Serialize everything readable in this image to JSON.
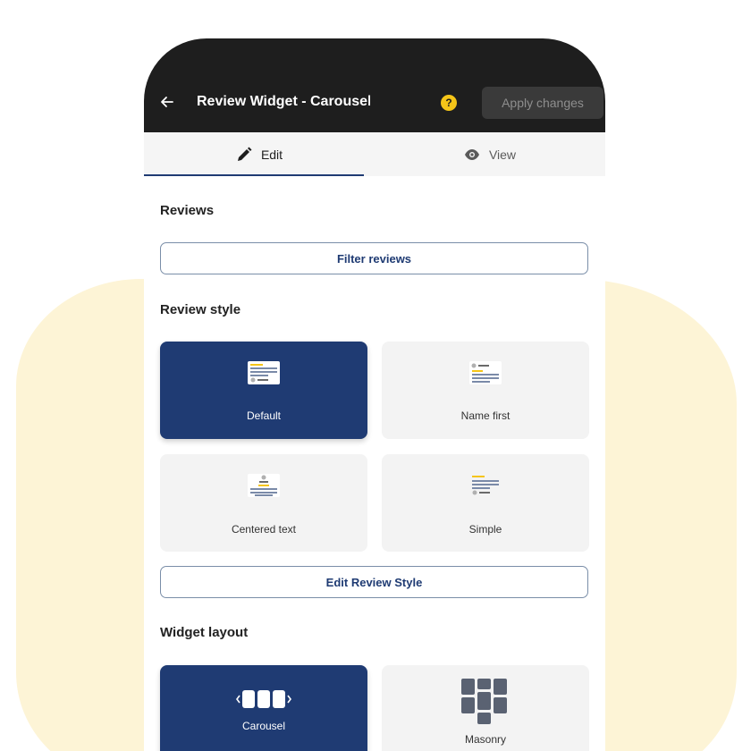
{
  "header": {
    "title": "Review Widget - Carousel",
    "help_label": "?",
    "apply_label": "Apply changes"
  },
  "tabs": [
    {
      "label": "Edit",
      "icon": "pencil-icon",
      "active": true
    },
    {
      "label": "View",
      "icon": "eye-icon",
      "active": false
    }
  ],
  "reviews": {
    "title": "Reviews",
    "filter_label": "Filter reviews"
  },
  "review_style": {
    "title": "Review style",
    "options": [
      {
        "label": "Default",
        "selected": true
      },
      {
        "label": "Name first",
        "selected": false
      },
      {
        "label": "Centered text",
        "selected": false
      },
      {
        "label": "Simple",
        "selected": false
      }
    ],
    "edit_label": "Edit Review Style"
  },
  "widget_layout": {
    "title": "Widget layout",
    "options": [
      {
        "label": "Carousel",
        "selected": true
      },
      {
        "label": "Masonry",
        "selected": false
      }
    ]
  },
  "colors": {
    "primary": "#1f3b73",
    "topbar": "#1e1e1e",
    "help": "#f5c518",
    "background_blob": "#fdf4d6"
  }
}
